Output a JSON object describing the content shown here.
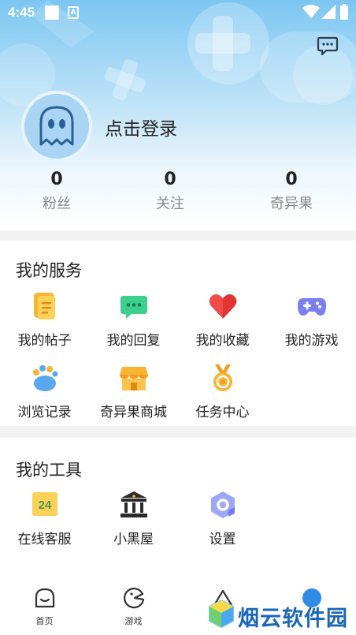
{
  "status_bar": {
    "time": "4:45"
  },
  "profile": {
    "login_prompt": "点击登录",
    "stats": [
      {
        "value": "0",
        "label": "粉丝"
      },
      {
        "value": "0",
        "label": "关注"
      },
      {
        "value": "0",
        "label": "奇异果"
      }
    ]
  },
  "services": {
    "title": "我的服务",
    "items": [
      {
        "label": "我的帖子",
        "icon": "post-icon"
      },
      {
        "label": "我的回复",
        "icon": "reply-icon"
      },
      {
        "label": "我的收藏",
        "icon": "favorite-icon"
      },
      {
        "label": "我的游戏",
        "icon": "gamepad-icon"
      },
      {
        "label": "浏览记录",
        "icon": "paw-icon"
      },
      {
        "label": "奇异果商城",
        "icon": "store-icon"
      },
      {
        "label": "任务中心",
        "icon": "medal-icon"
      }
    ]
  },
  "tools": {
    "title": "我的工具",
    "items": [
      {
        "label": "在线客服",
        "icon": "support-24-icon",
        "badge": "24"
      },
      {
        "label": "小黑屋",
        "icon": "building-icon"
      },
      {
        "label": "设置",
        "icon": "settings-icon"
      }
    ]
  },
  "tab_bar": {
    "tabs": [
      {
        "label": "首页",
        "icon": "home-icon"
      },
      {
        "label": "游戏",
        "icon": "game-tab-icon"
      },
      {
        "label": "",
        "icon": "triangle-tab-icon"
      },
      {
        "label": "",
        "icon": "profile-tab-icon"
      }
    ]
  },
  "watermark": {
    "text": "烟云软件园"
  },
  "colors": {
    "hero_top": "#7cc6f2",
    "avatar_bg": "#a9d4f4",
    "watermark": "#1a66b8",
    "orange": "#f7b531",
    "green": "#3ecf8e",
    "red": "#f04a4a",
    "purple": "#7b7ef0",
    "blue": "#5aa8f0"
  }
}
